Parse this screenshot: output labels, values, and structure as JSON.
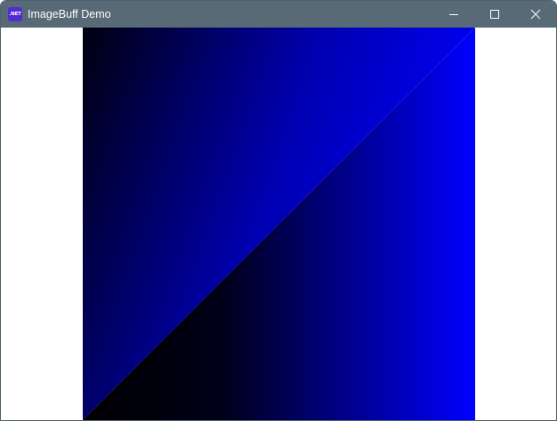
{
  "window": {
    "title": "ImageBuff Demo",
    "app_icon_text": ".NET",
    "app_icon_color": "#512bd4",
    "titlebar_color": "#576a76"
  },
  "controls": {
    "minimize_icon": "minimize-icon",
    "maximize_icon": "maximize-icon",
    "close_icon": "close-icon"
  },
  "image": {
    "description_colors": {
      "dark": "#000010",
      "blue": "#0000ff"
    },
    "upper_triangle_gradient": [
      "#000010",
      "#0000ff"
    ],
    "lower_triangle_gradient": [
      "#000000",
      "#0000ff"
    ]
  }
}
